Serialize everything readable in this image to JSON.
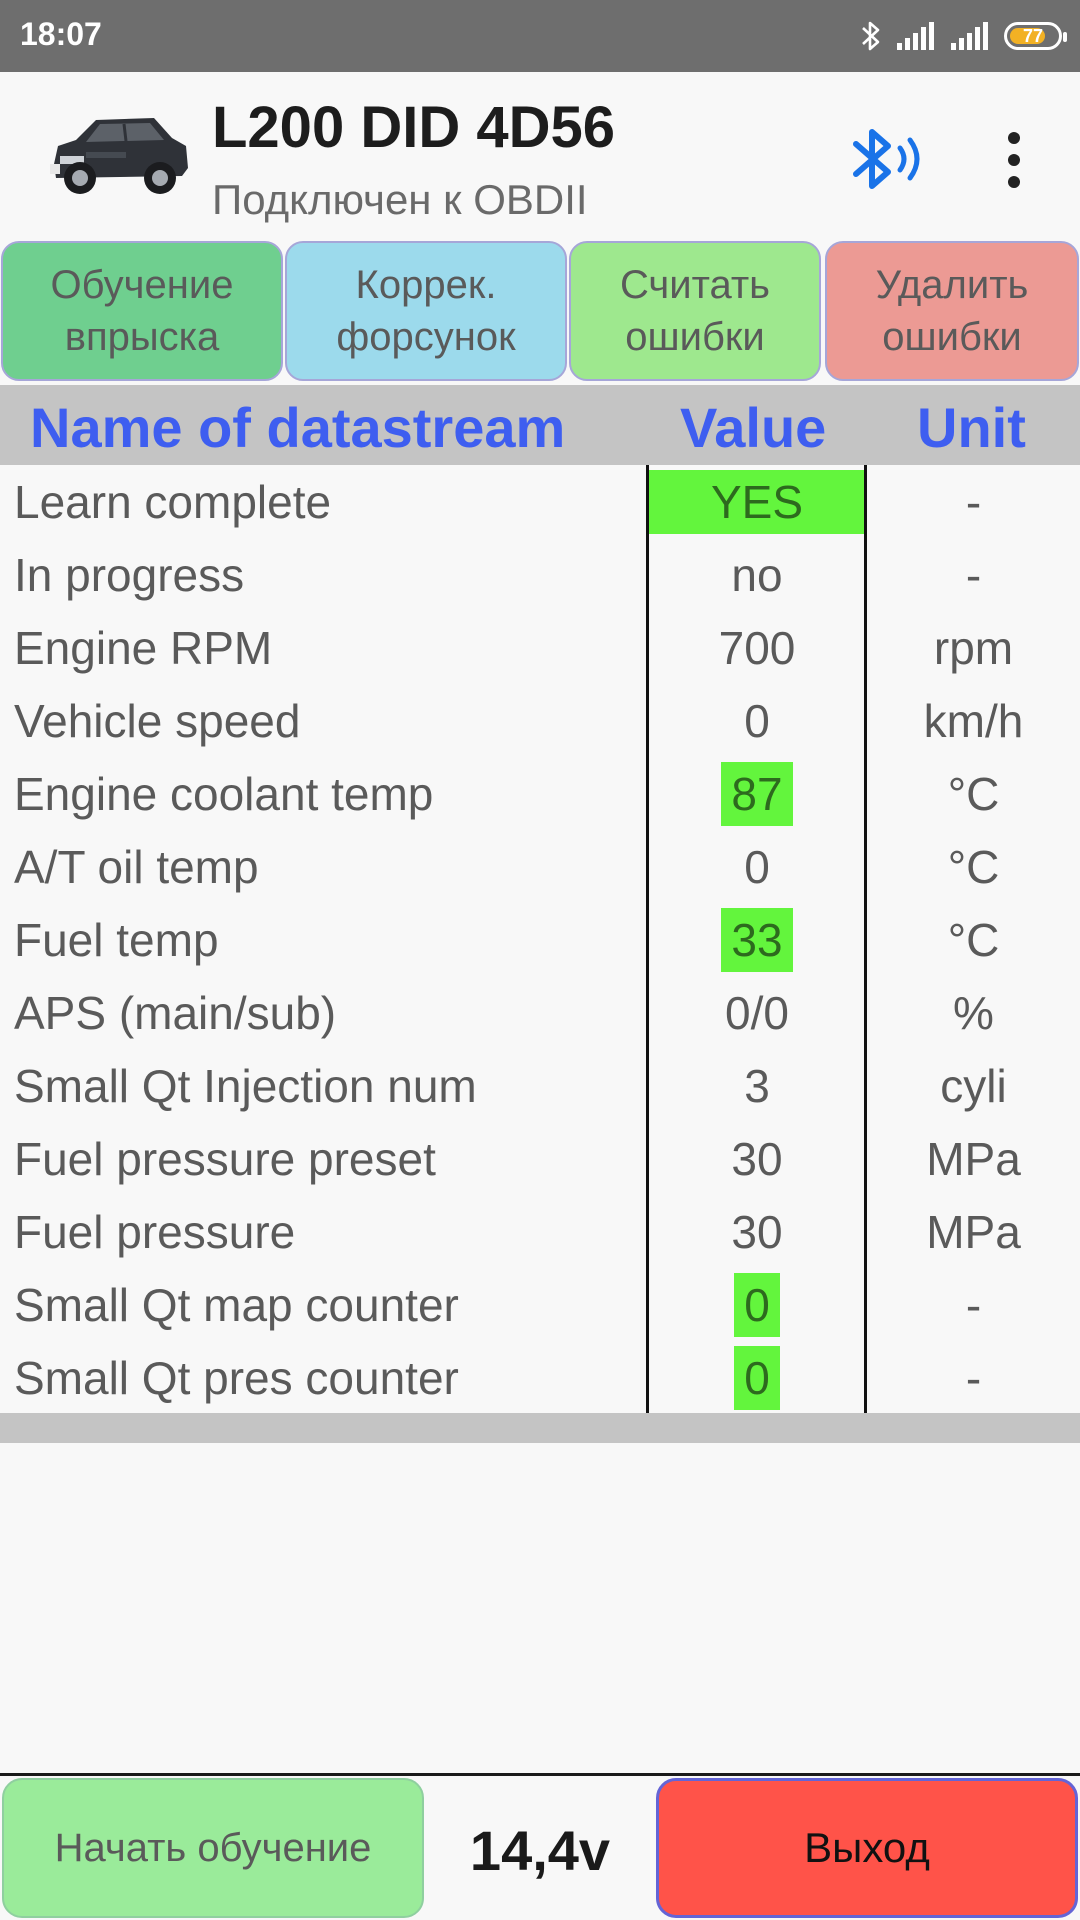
{
  "status_bar": {
    "time": "18:07",
    "battery_level": "77",
    "battery_fraction": 0.77,
    "icons": [
      "bluetooth-icon",
      "signal-icon",
      "signal-icon",
      "battery-icon"
    ]
  },
  "header": {
    "title": "L200 DID 4D56",
    "subtitle": "Подключен к OBDII",
    "bluetooth_color": "#1a73e8"
  },
  "actions": [
    {
      "label": "Обучение\nвпрыска",
      "color": "#6fcf8f"
    },
    {
      "label": "Коррек.\nфорсунок",
      "color": "#9cdaec"
    },
    {
      "label": "Считать\nошибки",
      "color": "#9ee88e"
    },
    {
      "label": "Удалить\nошибки",
      "color": "#ec9a94"
    }
  ],
  "table": {
    "headers": {
      "name": "Name of datastream",
      "value": "Value",
      "unit": "Unit"
    },
    "header_color": "#3e5ef0",
    "highlight_color": "#63f53d",
    "rows": [
      {
        "name": "Learn complete",
        "value": "YES",
        "unit": "-",
        "highlight": "full"
      },
      {
        "name": "In progress",
        "value": "no",
        "unit": "-",
        "highlight": ""
      },
      {
        "name": "Engine RPM",
        "value": "700",
        "unit": "rpm",
        "highlight": ""
      },
      {
        "name": "Vehicle speed",
        "value": "0",
        "unit": "km/h",
        "highlight": ""
      },
      {
        "name": "Engine coolant temp",
        "value": "87",
        "unit": "°C",
        "highlight": "text"
      },
      {
        "name": "A/T oil temp",
        "value": "0",
        "unit": "°C",
        "highlight": ""
      },
      {
        "name": "Fuel temp",
        "value": "33",
        "unit": "°C",
        "highlight": "text"
      },
      {
        "name": "APS (main/sub)",
        "value": "0/0",
        "unit": "%",
        "highlight": ""
      },
      {
        "name": "Small Qt Injection num",
        "value": "3",
        "unit": "cyli",
        "highlight": ""
      },
      {
        "name": "Fuel pressure preset",
        "value": "30",
        "unit": "MPa",
        "highlight": ""
      },
      {
        "name": "Fuel pressure",
        "value": "30",
        "unit": "MPa",
        "highlight": ""
      },
      {
        "name": "Small Qt map counter",
        "value": "0",
        "unit": "-",
        "highlight": "text"
      },
      {
        "name": "Small Qt pres counter",
        "value": "0",
        "unit": "-",
        "highlight": "text"
      }
    ]
  },
  "footer": {
    "start_label": "Начать обучение",
    "voltage": "14,4v",
    "exit_label": "Выход"
  }
}
